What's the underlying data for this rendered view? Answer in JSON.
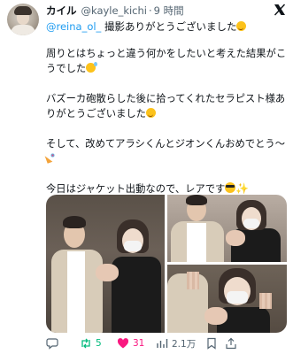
{
  "tweet": {
    "author_name": "カイル",
    "handle": "@kayle_kichi",
    "separator": "·",
    "time": "9 時間",
    "reply_mention": "@reina_ol_",
    "reply_text": " 撮影ありがとうございました",
    "paragraphs": [
      "周りとはちょっと違う何かをしたいと考えた結果がこうでした",
      "バズーカ砲散らした後に拾ってくれたセラピスト様ありがとうございました",
      "そして、改めてアラシくんとジオンくんおめでとう〜",
      "今日はジャケット出動なので、レアです"
    ]
  },
  "actions": {
    "replies": "",
    "retweets": "5",
    "likes": "31",
    "views": "2.1万"
  },
  "colors": {
    "link": "#1d9bf0",
    "muted": "#536471",
    "retweet_active": "#00ba7c",
    "like_active": "#f91880"
  },
  "icons": [
    "x-logo-icon",
    "smile-emoji",
    "sweat-emoji",
    "party-popper-emoji",
    "sunglasses-emoji",
    "sparkles-emoji",
    "reply-icon",
    "retweet-icon",
    "heart-icon",
    "views-icon",
    "bookmark-icon",
    "share-icon"
  ]
}
